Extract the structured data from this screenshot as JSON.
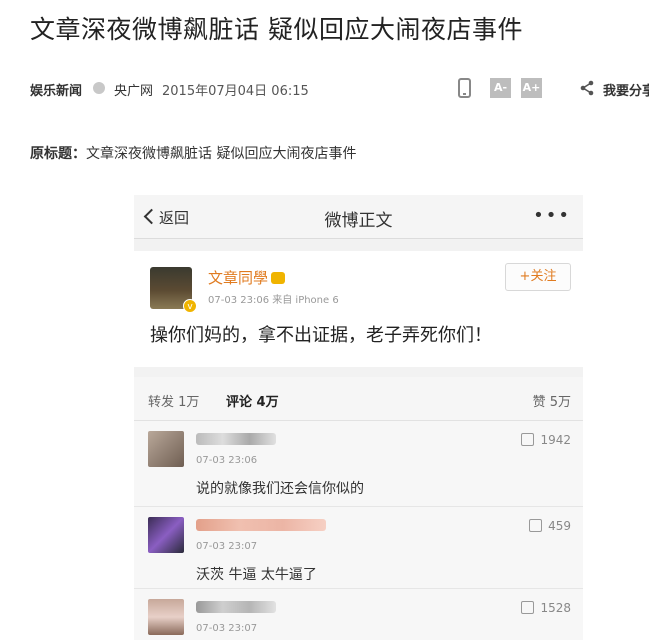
{
  "article": {
    "headline": "文章深夜微博飙脏话 疑似回应大闹夜店事件",
    "channel": "娱乐新闻",
    "source": "央广网",
    "datetime": "2015年07月04日 06:15",
    "font_small": "A-",
    "font_large": "A+",
    "share_label": "我要分享",
    "original_title_label": "原标题：",
    "original_title": "文章深夜微博飙脏话 疑似回应大闹夜店事件"
  },
  "weibo": {
    "nav": {
      "back_label": "返回",
      "title": "微博正文",
      "more": "•••"
    },
    "post": {
      "username": "文章同學",
      "time_device": "07-03 23:06  来自 iPhone 6",
      "follow_label": "+关注",
      "text": "操你们妈的，拿不出证据，老子弄死你们！"
    },
    "tabs": {
      "repost": "转发 1万",
      "comment": "评论 4万",
      "like": "赞 5万"
    },
    "comments": [
      {
        "time": "07-03 23:06",
        "text": "说的就像我们还会信你似的",
        "likes": "1942"
      },
      {
        "time": "07-03 23:07",
        "text": "沃茨 牛逼 太牛逼了",
        "likes": "459"
      },
      {
        "time": "07-03 23:07",
        "text": "",
        "likes": "1528"
      }
    ]
  },
  "colors": {
    "accent": "#e07b20",
    "verified": "#f0b400"
  },
  "icons": [
    "mobile-icon",
    "share-icon",
    "back-arrow-icon",
    "more-icon",
    "verified-badge-icon",
    "thumb-up-icon"
  ]
}
